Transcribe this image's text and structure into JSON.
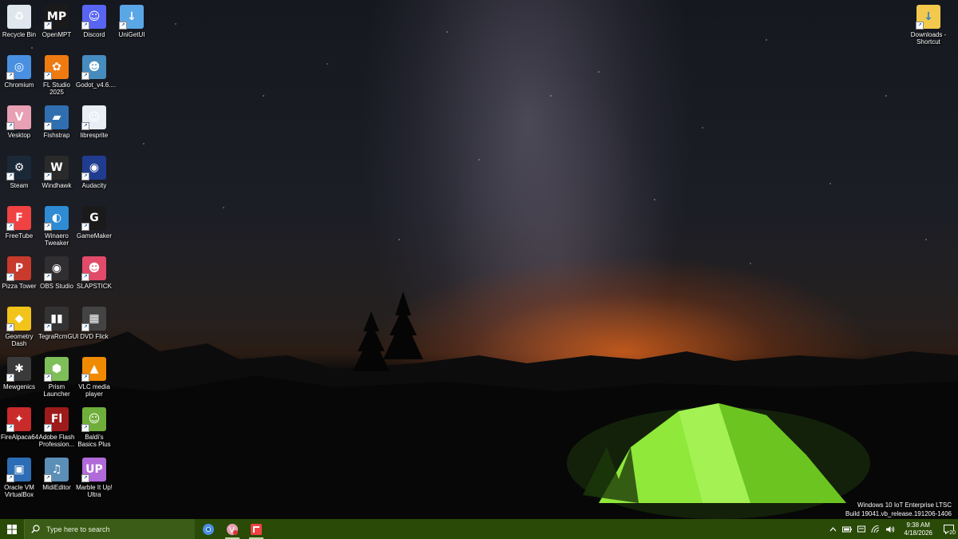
{
  "desktop": {
    "icons": [
      {
        "label": "Recycle Bin",
        "icon": "recycle-bin-icon",
        "color": "#dfe6ee",
        "glyph": "♻",
        "shortcut": false
      },
      {
        "label": "OpenMPT",
        "icon": "openmpt-icon",
        "color": "#1a1a1a",
        "glyph": "MP",
        "shortcut": true
      },
      {
        "label": "Discord",
        "icon": "discord-icon",
        "color": "#5865f2",
        "glyph": "☺",
        "shortcut": true
      },
      {
        "label": "UniGetUI",
        "icon": "unigetui-icon",
        "color": "#5aa7e6",
        "glyph": "↓",
        "shortcut": true
      },
      {
        "label": "Chromium",
        "icon": "chromium-icon",
        "color": "#4a90e2",
        "glyph": "◎",
        "shortcut": true
      },
      {
        "label": "FL Studio 2025",
        "icon": "fl-studio-icon",
        "color": "#f07a12",
        "glyph": "✿",
        "shortcut": true
      },
      {
        "label": "Godot_v4.6....",
        "icon": "godot-icon",
        "color": "#478cbf",
        "glyph": "☻",
        "shortcut": true
      },
      {
        "label": "Vesktop",
        "icon": "vesktop-icon",
        "color": "#e8a0b4",
        "glyph": "V",
        "shortcut": true
      },
      {
        "label": "Fishstrap",
        "icon": "fishstrap-icon",
        "color": "#2f6fb0",
        "glyph": "▰",
        "shortcut": true
      },
      {
        "label": "libresprite",
        "icon": "libresprite-icon",
        "color": "#e9eef6",
        "glyph": "☺",
        "shortcut": true
      },
      {
        "label": "Steam",
        "icon": "steam-icon",
        "color": "#1b2838",
        "glyph": "⚙",
        "shortcut": true
      },
      {
        "label": "Windhawk",
        "icon": "windhawk-icon",
        "color": "#2a2a2a",
        "glyph": "W",
        "shortcut": true
      },
      {
        "label": "Audacity",
        "icon": "audacity-icon",
        "color": "#1f3c8f",
        "glyph": "◉",
        "shortcut": true
      },
      {
        "label": "FreeTube",
        "icon": "freetube-icon",
        "color": "#f04242",
        "glyph": "F",
        "shortcut": true
      },
      {
        "label": "Winaero Tweaker",
        "icon": "winaero-tweaker-icon",
        "color": "#2e8bd4",
        "glyph": "◐",
        "shortcut": true
      },
      {
        "label": "GameMaker",
        "icon": "gamemaker-icon",
        "color": "#1a1a1a",
        "glyph": "G",
        "shortcut": true
      },
      {
        "label": "Pizza Tower",
        "icon": "pizza-tower-icon",
        "color": "#c73a2c",
        "glyph": "P",
        "shortcut": true
      },
      {
        "label": "OBS Studio",
        "icon": "obs-studio-icon",
        "color": "#302e31",
        "glyph": "◉",
        "shortcut": true
      },
      {
        "label": "SLAPSTICK",
        "icon": "slapstick-icon",
        "color": "#e24a6a",
        "glyph": "☻",
        "shortcut": true
      },
      {
        "label": "Geometry Dash",
        "icon": "geometry-dash-icon",
        "color": "#f2c318",
        "glyph": "◆",
        "shortcut": true
      },
      {
        "label": "TegraRcmGUI",
        "icon": "tegrarcmgui-icon",
        "color": "#333333",
        "glyph": "▮▮",
        "shortcut": true
      },
      {
        "label": "DVD Flick",
        "icon": "dvd-flick-icon",
        "color": "#444444",
        "glyph": "▦",
        "shortcut": true
      },
      {
        "label": "Mewgenics",
        "icon": "mewgenics-icon",
        "color": "#3a3a3a",
        "glyph": "✱",
        "shortcut": true
      },
      {
        "label": "Prism Launcher",
        "icon": "prism-launcher-icon",
        "color": "#7fbf5a",
        "glyph": "⬢",
        "shortcut": true
      },
      {
        "label": "VLC media player",
        "icon": "vlc-icon",
        "color": "#f08a00",
        "glyph": "▲",
        "shortcut": true
      },
      {
        "label": "FireAlpaca64",
        "icon": "firealpaca-icon",
        "color": "#c92a2a",
        "glyph": "✦",
        "shortcut": true
      },
      {
        "label": "Adobe Flash Profession...",
        "icon": "adobe-flash-icon",
        "color": "#9e1b1b",
        "glyph": "Fl",
        "shortcut": true
      },
      {
        "label": "Baldi's Basics Plus",
        "icon": "baldis-basics-icon",
        "color": "#6fae3a",
        "glyph": "☺",
        "shortcut": true
      },
      {
        "label": "Oracle VM VirtualBox",
        "icon": "virtualbox-icon",
        "color": "#2d6db5",
        "glyph": "▣",
        "shortcut": true
      },
      {
        "label": "MidiEditor",
        "icon": "midieditor-icon",
        "color": "#5c8fb8",
        "glyph": "♫",
        "shortcut": true
      },
      {
        "label": "Marble It Up! Ultra",
        "icon": "marble-it-up-icon",
        "color": "#b16ad9",
        "glyph": "UP",
        "shortcut": true
      }
    ],
    "right_icon": {
      "label": "Downloads - Shortcut",
      "icon": "downloads-folder-icon",
      "color": "#f2c94c",
      "glyph": "↓"
    }
  },
  "watermark": {
    "line1": "Windows 10 IoT Enterprise LTSC",
    "line2": "Build 19041.vb_release.191206-1406"
  },
  "taskbar": {
    "search_placeholder": "Type here to search",
    "pinned": [
      {
        "name": "taskbar-chromium",
        "icon": "chromium-icon",
        "color": "#4a90e2",
        "active": false
      },
      {
        "name": "taskbar-vesktop",
        "icon": "vesktop-icon",
        "color": "#e8a0b4",
        "active": true
      },
      {
        "name": "taskbar-freetube",
        "icon": "freetube-icon",
        "color": "#f04242",
        "active": true
      }
    ],
    "tray": {
      "time": "9:38 AM",
      "date": "4/18/2026",
      "notification_count": "20"
    },
    "colors": {
      "bar": "#2a4a08",
      "search": "#3a5c17"
    }
  }
}
